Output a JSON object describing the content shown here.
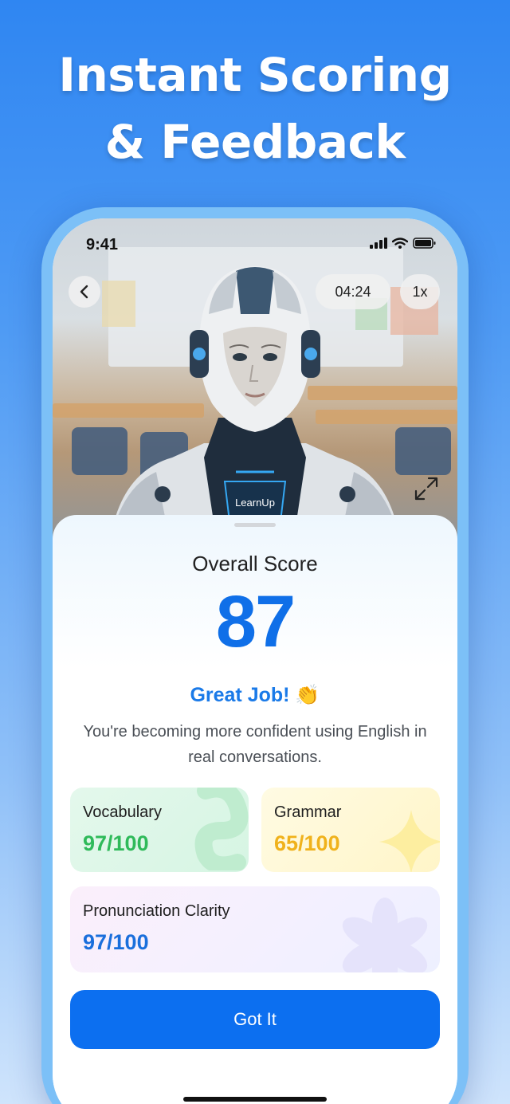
{
  "headline": {
    "line1": "Instant Scoring",
    "line2": "& Feedback"
  },
  "status_bar": {
    "time": "9:41"
  },
  "video": {
    "back_icon": "chevron-left-icon",
    "timer": "04:24",
    "speed": "1x",
    "badge": "LearnUp",
    "expand_icon": "expand-arrows-icon"
  },
  "score": {
    "title": "Overall Score",
    "value": "87",
    "headline": "Great Job! 👏",
    "message": "You're becoming more confident using English in real conversations."
  },
  "metrics": [
    {
      "label": "Vocabulary",
      "value": "97/100",
      "color": "#2fba5a"
    },
    {
      "label": "Grammar",
      "value": "65/100",
      "color": "#f0b21c"
    },
    {
      "label": "Pronunciation Clarity",
      "value": "97/100",
      "color": "#1a6fdc"
    }
  ],
  "cta": {
    "label": "Got It"
  },
  "colors": {
    "accent": "#0c6ff0",
    "score": "#0f6fe8"
  }
}
